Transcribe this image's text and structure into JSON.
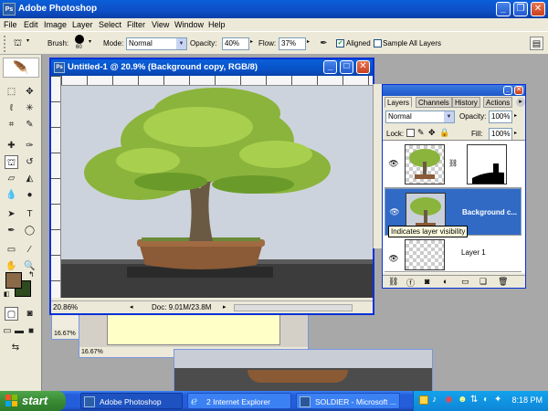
{
  "app": {
    "title": "Adobe Photoshop"
  },
  "menu": [
    "File",
    "Edit",
    "Image",
    "Layer",
    "Select",
    "Filter",
    "View",
    "Window",
    "Help"
  ],
  "options": {
    "brush_label": "Brush:",
    "brush_size": "60",
    "mode_label": "Mode:",
    "mode_value": "Normal",
    "opacity_label": "Opacity:",
    "opacity_value": "40%",
    "flow_label": "Flow:",
    "flow_value": "37%",
    "aligned_label": "Aligned",
    "aligned_checked": true,
    "sample_all_label": "Sample All Layers",
    "sample_all_checked": false
  },
  "document": {
    "title": "Untitled-1 @ 20.9% (Background copy, RGB/8)",
    "zoom": "20.86%",
    "doc_info": "Doc: 9.01M/23.8M"
  },
  "background_windows": {
    "zoom_a": "16.67%",
    "zoom_b": "16.67%"
  },
  "layers_panel": {
    "tabs": [
      "Layers",
      "Channels",
      "History",
      "Actions"
    ],
    "blend_mode": "Normal",
    "opacity_label": "Opacity:",
    "opacity_value": "100%",
    "lock_label": "Lock:",
    "fill_label": "Fill:",
    "fill_value": "100%",
    "layers": [
      {
        "name": "",
        "selected": false
      },
      {
        "name": "Background c...",
        "selected": true
      },
      {
        "name": "Layer 1",
        "selected": false
      }
    ]
  },
  "tooltip": {
    "text": "Indicates layer visibility"
  },
  "taskbar": {
    "start_label": "start",
    "tasks": [
      {
        "label": "Adobe Photoshop",
        "active": true
      },
      {
        "label": "2 Internet Explorer",
        "active": false
      },
      {
        "label": "SOLDIER - Microsoft ...",
        "active": false
      }
    ],
    "clock": "8:18 PM"
  },
  "colors": {
    "xp_blue": "#0a5fd8",
    "selection_blue": "#316ac5",
    "foreground_color": "#8b6a4a",
    "background_color": "#2e4a1e"
  }
}
